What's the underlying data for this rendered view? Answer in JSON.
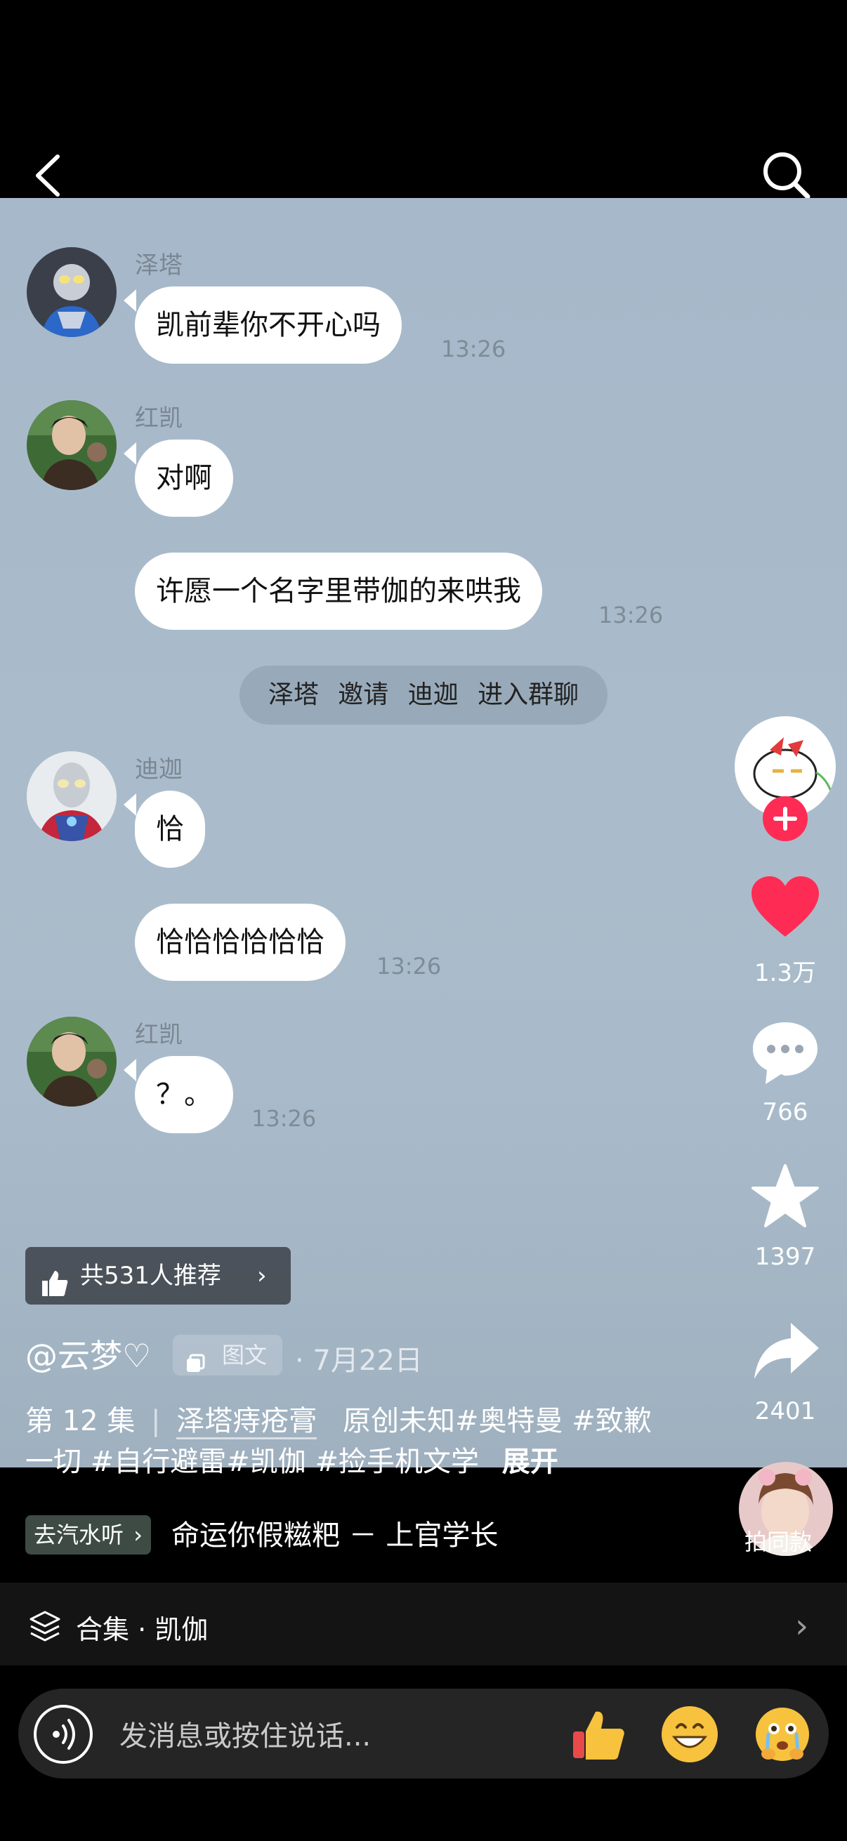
{
  "nav": {
    "back_icon": "chevron-left-icon",
    "search_icon": "search-icon"
  },
  "chat": {
    "groups": [
      {
        "sender": "泽塔",
        "avatar": "ultraman-z-avatar",
        "messages": [
          {
            "text": "凯前辈你不开心吗",
            "time": "13:26"
          }
        ]
      },
      {
        "sender": "红凯",
        "avatar": "hong-kai-avatar",
        "messages": [
          {
            "text": "对啊",
            "time": ""
          },
          {
            "text": "许愿一个名字里带伽的来哄我",
            "time": "13:26"
          }
        ]
      },
      {
        "system": "泽塔 邀请 迪迦 进入群聊"
      },
      {
        "sender": "迪迦",
        "avatar": "ultraman-tiga-avatar",
        "messages": [
          {
            "text": "恰",
            "time": ""
          },
          {
            "text": "恰恰恰恰恰恰",
            "time": "13:26"
          }
        ]
      },
      {
        "sender": "红凯",
        "avatar": "hong-kai-avatar",
        "messages": [
          {
            "text": "？。",
            "time": "13:26"
          }
        ]
      }
    ]
  },
  "sidebar": {
    "follow_icon": "plus-icon",
    "likes": "1.3万",
    "comments": "766",
    "favorites": "1397",
    "shares": "2401",
    "same_style": "拍同款"
  },
  "post": {
    "recommend": "共531人推荐",
    "author": "@云梦♡",
    "type_tag": "图文",
    "date": "· 7月22日",
    "episode": "第 12 集",
    "episode_link": "泽塔痔疮膏",
    "caption_rest": "原创未知#奥特曼 #致歉一切 #自行避雷#凯伽 #捡手机文学",
    "expand": "展开",
    "soda_badge": "去汽水听",
    "music": "命运你假糍粑 － 上官学长"
  },
  "collection": {
    "label": "合集 · 凯伽"
  },
  "composer": {
    "placeholder": "发消息或按住说话..."
  },
  "colors": {
    "like": "#fe2c55",
    "follow": "#fe2c55"
  }
}
